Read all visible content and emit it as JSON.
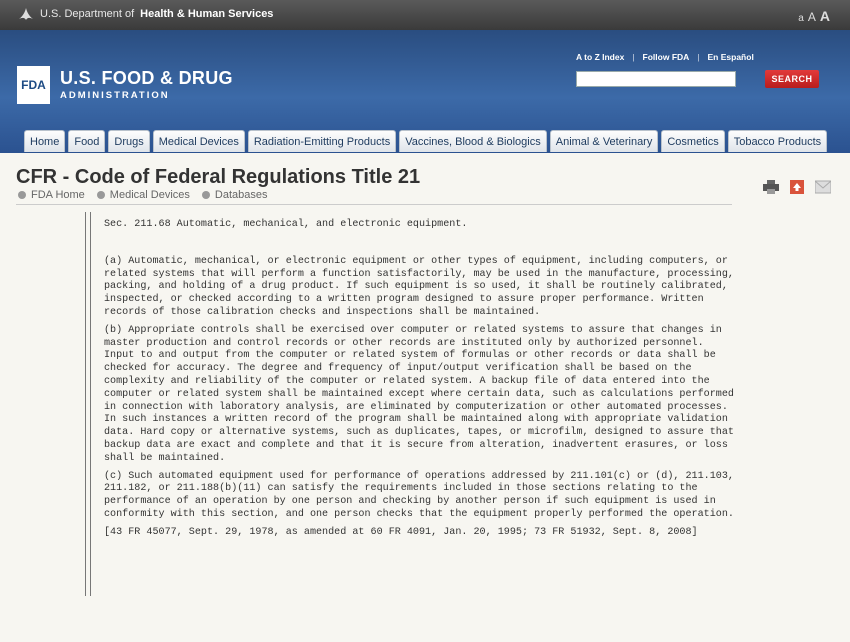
{
  "hhs": {
    "prefix": "U.S. Department of",
    "bold": "Health & Human Services"
  },
  "text_size": {
    "small": "a",
    "medium": "A",
    "large": "A"
  },
  "logo": {
    "mark": "FDA",
    "title": "U.S. FOOD & DRUG",
    "subtitle": "ADMINISTRATION"
  },
  "utility_links": [
    "A to Z Index",
    "Follow FDA",
    "En Español"
  ],
  "search": {
    "placeholder": "",
    "button": "SEARCH"
  },
  "tabs": [
    "Home",
    "Food",
    "Drugs",
    "Medical Devices",
    "Radiation-Emitting Products",
    "Vaccines, Blood & Biologics",
    "Animal & Veterinary",
    "Cosmetics",
    "Tobacco Products"
  ],
  "page_title": "CFR - Code of Federal Regulations Title 21",
  "breadcrumb": [
    "FDA Home",
    "Medical Devices",
    "Databases"
  ],
  "icons": [
    "print-icon",
    "share-icon",
    "email-icon"
  ],
  "regulation": {
    "heading": "Sec. 211.68 Automatic, mechanical, and electronic equipment.",
    "paragraphs": [
      "(a) Automatic, mechanical, or electronic equipment or other types of equipment, including computers, or related systems that will perform a function satisfactorily, may be used in the manufacture, processing, packing, and holding of a drug product. If such equipment is so used, it shall be routinely calibrated, inspected, or checked according to a written program designed to assure proper performance. Written records of those calibration checks and inspections shall be maintained.",
      "(b) Appropriate controls shall be exercised over computer or related systems to assure that changes in master production and control records or other records are instituted only by authorized personnel. Input to and output from the computer or related system of formulas or other records or data shall be checked for accuracy. The degree and frequency of input/output verification shall be based on the complexity and reliability of the computer or related system. A backup file of data entered into the computer or related system shall be maintained except where certain data, such as calculations performed in connection with laboratory analysis, are eliminated by computerization or other automated processes. In such instances a written record of the program shall be maintained along with appropriate validation data. Hard copy or alternative systems, such as duplicates, tapes, or microfilm, designed to assure that backup data are exact and complete and that it is secure from alteration, inadvertent erasures, or loss shall be maintained.",
      "(c) Such automated equipment used for performance of operations addressed by 211.101(c) or (d), 211.103, 211.182, or 211.188(b)(11) can satisfy the requirements included in those sections relating to the performance of an operation by one person and checking by another person if such equipment is used in conformity with this section, and one person checks that the equipment properly performed the operation.",
      "[43 FR 45077, Sept. 29, 1978, as amended at 60 FR 4091, Jan. 20, 1995; 73 FR 51932, Sept. 8, 2008]"
    ]
  }
}
